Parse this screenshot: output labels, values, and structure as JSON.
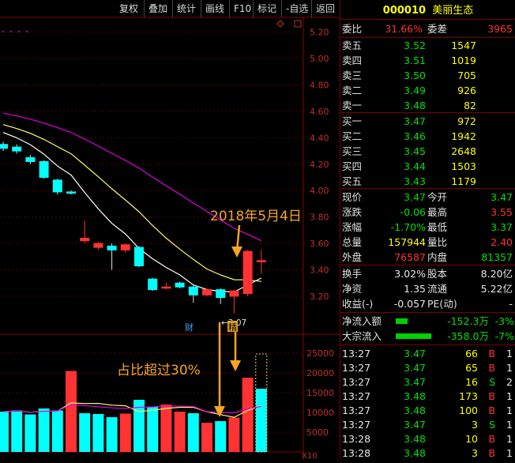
{
  "toolbar": {
    "buttons": [
      "复权",
      "叠加",
      "统计",
      "画线",
      "F10",
      "标记",
      "-自选",
      "返回"
    ]
  },
  "price_axis": {
    "labels": [
      "5.20",
      "5.00",
      "4.80",
      "4.60",
      "4.40",
      "4.20",
      "4.00",
      "3.80",
      "3.60",
      "3.40",
      "3.20"
    ]
  },
  "volume_axis": {
    "labels": [
      "25000",
      "20000",
      "15000",
      "10000",
      "5000"
    ],
    "unit": "X10"
  },
  "annotations": {
    "date_label": "2018年5月4日",
    "ratio_label": "占比超过30%",
    "low_price": "←3.07",
    "event_cai": "财",
    "event_jing": "精"
  },
  "colors": {
    "up": "#ff3333",
    "down": "#00ffff",
    "ma5": "#ffffff",
    "ma10": "#ffff66",
    "ma20": "#e000e0",
    "ma60": "#00d000",
    "annotation": "#f5a623"
  },
  "chart_data": {
    "type": "candlestick",
    "ylim": [
      3.05,
      5.3
    ],
    "candles": [
      {
        "o": 4.35,
        "c": 4.32,
        "h": 4.37,
        "l": 4.3
      },
      {
        "o": 4.33,
        "c": 4.3,
        "h": 4.35,
        "l": 4.28
      },
      {
        "o": 4.25,
        "c": 4.22,
        "h": 4.27,
        "l": 4.2
      },
      {
        "o": 4.22,
        "c": 4.1,
        "h": 4.23,
        "l": 4.09
      },
      {
        "o": 4.08,
        "c": 3.99,
        "h": 4.09,
        "l": 3.97
      },
      {
        "o": 3.99,
        "c": 3.98,
        "h": 4.0,
        "l": 3.97
      },
      {
        "o": 3.62,
        "c": 3.64,
        "h": 3.77,
        "l": 3.6
      },
      {
        "o": 3.57,
        "c": 3.6,
        "h": 3.61,
        "l": 3.55
      },
      {
        "o": 3.58,
        "c": 3.55,
        "h": 3.6,
        "l": 3.4
      },
      {
        "o": 3.55,
        "c": 3.59,
        "h": 3.6,
        "l": 3.53
      },
      {
        "o": 3.57,
        "c": 3.43,
        "h": 3.58,
        "l": 3.42
      },
      {
        "o": 3.33,
        "c": 3.25,
        "h": 3.34,
        "l": 3.24
      },
      {
        "o": 3.27,
        "c": 3.27,
        "h": 3.3,
        "l": 3.25
      },
      {
        "o": 3.3,
        "c": 3.27,
        "h": 3.31,
        "l": 3.26
      },
      {
        "o": 3.27,
        "c": 3.21,
        "h": 3.29,
        "l": 3.15
      },
      {
        "o": 3.21,
        "c": 3.25,
        "h": 3.26,
        "l": 3.2
      },
      {
        "o": 3.25,
        "c": 3.19,
        "h": 3.26,
        "l": 3.14
      },
      {
        "o": 3.2,
        "c": 3.24,
        "h": 3.25,
        "l": 3.07
      },
      {
        "o": 3.22,
        "c": 3.54,
        "h": 3.55,
        "l": 3.2
      },
      {
        "o": 3.47,
        "c": 3.47,
        "h": 3.55,
        "l": 3.37
      }
    ],
    "volumes": [
      {
        "v": 10200,
        "up": false
      },
      {
        "v": 10500,
        "up": false
      },
      {
        "v": 9500,
        "up": false
      },
      {
        "v": 11000,
        "up": false
      },
      {
        "v": 10500,
        "up": false
      },
      {
        "v": 20500,
        "up": true
      },
      {
        "v": 9800,
        "up": false
      },
      {
        "v": 9600,
        "up": false
      },
      {
        "v": 8800,
        "up": false
      },
      {
        "v": 9700,
        "up": true
      },
      {
        "v": 13200,
        "up": false
      },
      {
        "v": 11400,
        "up": false
      },
      {
        "v": 12000,
        "up": true
      },
      {
        "v": 10200,
        "up": true
      },
      {
        "v": 9800,
        "up": false
      },
      {
        "v": 7400,
        "up": true
      },
      {
        "v": 7800,
        "up": false
      },
      {
        "v": 8700,
        "up": true
      },
      {
        "v": 18800,
        "up": true
      },
      {
        "v": 16000,
        "up": false
      }
    ],
    "volume_ylim": [
      0,
      28000
    ],
    "last_volume_outline": 24800
  },
  "quote": {
    "code": "000010",
    "name": "美丽生态",
    "weibi_label": "委比",
    "weibi": "31.66%",
    "weicha_label": "委差",
    "weicha": "3965",
    "asks": [
      {
        "label": "卖五",
        "price": "3.52",
        "vol": "1547"
      },
      {
        "label": "卖四",
        "price": "3.51",
        "vol": "1019"
      },
      {
        "label": "卖三",
        "price": "3.50",
        "vol": "705"
      },
      {
        "label": "卖二",
        "price": "3.49",
        "vol": "926"
      },
      {
        "label": "卖一",
        "price": "3.48",
        "vol": "82"
      }
    ],
    "bids": [
      {
        "label": "买一",
        "price": "3.47",
        "vol": "972"
      },
      {
        "label": "买二",
        "price": "3.46",
        "vol": "1942"
      },
      {
        "label": "买三",
        "price": "3.45",
        "vol": "2648"
      },
      {
        "label": "买四",
        "price": "3.44",
        "vol": "1503"
      },
      {
        "label": "买五",
        "price": "3.43",
        "vol": "1179"
      }
    ],
    "stats": [
      {
        "l1": "现价",
        "v1": "3.47",
        "c1": "grn",
        "l2": "今开",
        "v2": "3.47",
        "c2": "grn"
      },
      {
        "l1": "涨跌",
        "v1": "-0.06",
        "c1": "grn",
        "l2": "最高",
        "v2": "3.55",
        "c2": "red"
      },
      {
        "l1": "涨幅",
        "v1": "-1.70%",
        "c1": "grn",
        "l2": "最低",
        "v2": "3.37",
        "c2": "grn"
      },
      {
        "l1": "总量",
        "v1": "157944",
        "c1": "yel",
        "l2": "量比",
        "v2": "2.40",
        "c2": "red"
      },
      {
        "l1": "外盘",
        "v1": "76587",
        "c1": "red",
        "l2": "内盘",
        "v2": "81357",
        "c2": "grn"
      }
    ],
    "fund": [
      {
        "l1": "换手",
        "v1": "3.02%",
        "c1": "wht",
        "l2": "股本",
        "v2": "8.20亿",
        "c2": "wht"
      },
      {
        "l1": "净资",
        "v1": "1.35",
        "c1": "wht",
        "l2": "流通",
        "v2": "5.22亿",
        "c2": "wht"
      },
      {
        "l1": "收益(-)",
        "v1": "-0.057",
        "c1": "wht",
        "l2": "PE(动)",
        "v2": "-",
        "c2": "wht"
      }
    ],
    "flows": [
      {
        "label": "净流入额",
        "value": "-152.3万",
        "pct": "-3%",
        "bar": 0.3
      },
      {
        "label": "大宗流入",
        "value": "-358.0万",
        "pct": "-7%",
        "bar": 0.9
      }
    ],
    "ticks": [
      {
        "time": "13:27",
        "price": "3.47",
        "vol": "66",
        "side": "B",
        "n": "1"
      },
      {
        "time": "13:27",
        "price": "3.47",
        "vol": "65",
        "side": "B",
        "n": "1"
      },
      {
        "time": "13:27",
        "price": "3.47",
        "vol": "16",
        "side": "S",
        "n": "2"
      },
      {
        "time": "13:27",
        "price": "3.48",
        "vol": "173",
        "side": "B",
        "n": "1"
      },
      {
        "time": "13:27",
        "price": "3.48",
        "vol": "100",
        "side": "B",
        "n": "1"
      },
      {
        "time": "13:27",
        "price": "3.47",
        "vol": "3",
        "side": "S",
        "n": "1"
      },
      {
        "time": "13:28",
        "price": "3.48",
        "vol": "10",
        "side": "B",
        "n": "1"
      },
      {
        "time": "13:28",
        "price": "3.48",
        "vol": "3",
        "side": "B",
        "n": "1"
      }
    ]
  }
}
